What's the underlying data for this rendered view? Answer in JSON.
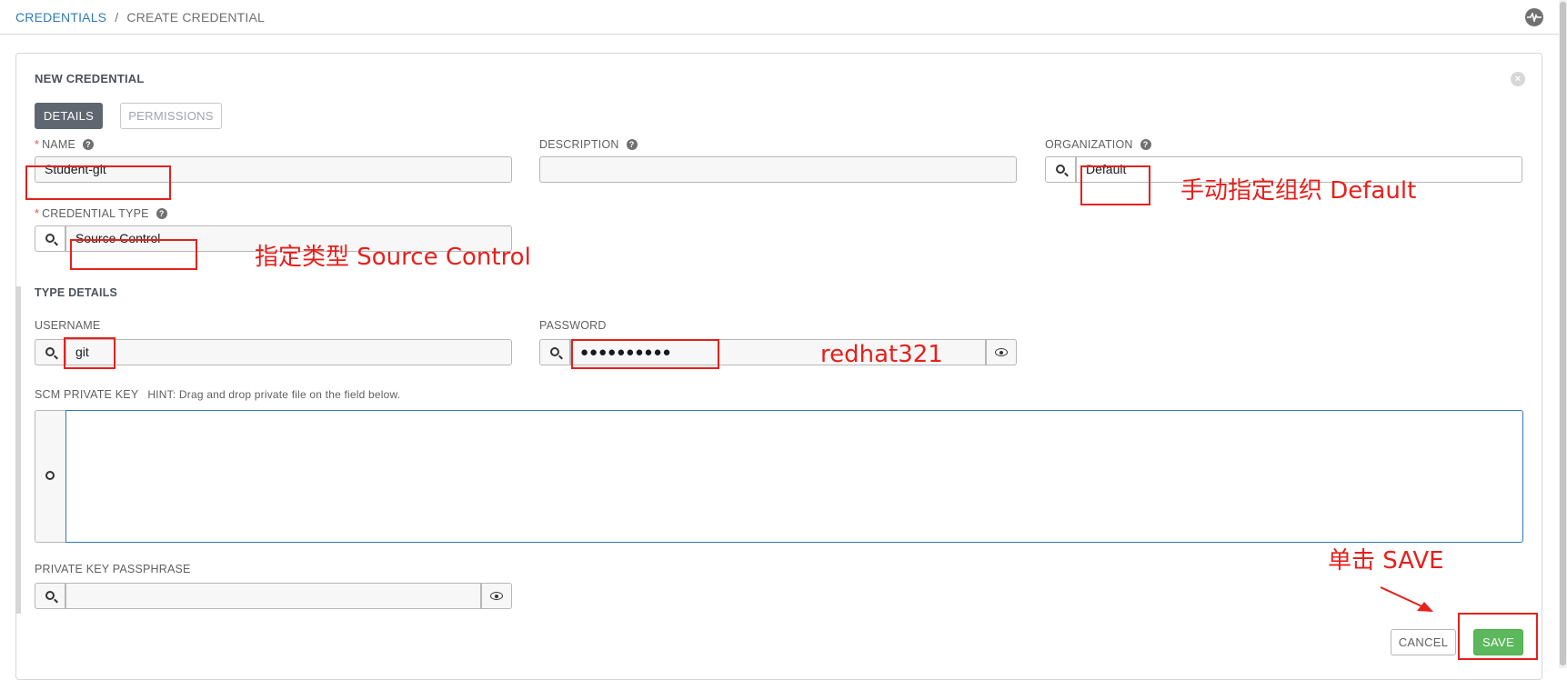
{
  "breadcrumb": {
    "root": "CREDENTIALS",
    "separator": "/",
    "current": "CREATE CREDENTIAL"
  },
  "header": {
    "activity_icon": "activity-stream-icon"
  },
  "panel": {
    "title": "NEW CREDENTIAL",
    "close_icon": "close-icon"
  },
  "tabs": {
    "details": "DETAILS",
    "permissions": "PERMISSIONS"
  },
  "fields": {
    "name": {
      "label": "NAME",
      "required": "*",
      "value": "Student-git"
    },
    "description": {
      "label": "DESCRIPTION",
      "value": ""
    },
    "organization": {
      "label": "ORGANIZATION",
      "value": "Default"
    },
    "credential_type": {
      "label": "CREDENTIAL TYPE",
      "required": "*",
      "value": "Source Control"
    }
  },
  "type_details": {
    "title": "TYPE DETAILS",
    "username": {
      "label": "USERNAME",
      "value": "git"
    },
    "password": {
      "label": "PASSWORD",
      "value": "●●●●●●●●●●"
    },
    "scm_private_key": {
      "label": "SCM PRIVATE KEY",
      "hint": "HINT: Drag and drop private file on the field below.",
      "value": ""
    },
    "private_key_passphrase": {
      "label": "PRIVATE KEY PASSPHRASE",
      "value": ""
    }
  },
  "buttons": {
    "cancel": "CANCEL",
    "save": "SAVE"
  },
  "annotations": {
    "organization_note": "手动指定组织 Default",
    "type_note": "指定类型 Source Control",
    "password_note": "redhat321",
    "save_note": "单击 SAVE"
  },
  "colors": {
    "link": "#337ab7",
    "annotation": "#e6201c",
    "save": "#5cb85c",
    "tab_active": "#5e6770"
  }
}
